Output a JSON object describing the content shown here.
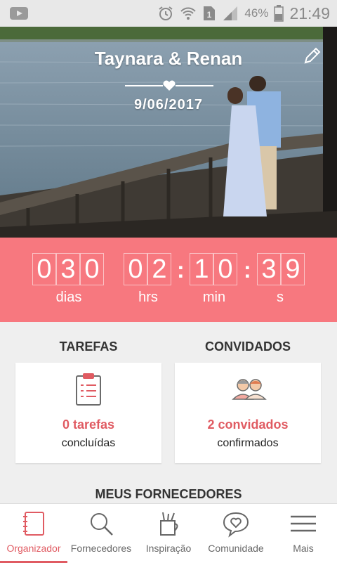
{
  "status_bar": {
    "battery_pct": "46%",
    "time": "21:49"
  },
  "hero": {
    "couple_names": "Taynara & Renan",
    "wedding_date": "9/06/2017"
  },
  "countdown": {
    "days": [
      "0",
      "3",
      "0"
    ],
    "hours": [
      "0",
      "2"
    ],
    "minutes": [
      "1",
      "0"
    ],
    "seconds": [
      "3",
      "9"
    ],
    "separator": ":",
    "labels": {
      "days": "dias",
      "hours": "hrs",
      "minutes": "min",
      "seconds": "s"
    }
  },
  "tasks": {
    "title": "TAREFAS",
    "count": "0 tarefas",
    "sub": "concluídas"
  },
  "guests": {
    "title": "CONVIDADOS",
    "count": "2 convidados",
    "sub": "confirmados"
  },
  "suppliers_title": "MEUS FORNECEDORES",
  "tabs": [
    {
      "label": "Organizador"
    },
    {
      "label": "Fornecedores"
    },
    {
      "label": "Inspiração"
    },
    {
      "label": "Comunidade"
    },
    {
      "label": "Mais"
    }
  ],
  "colors": {
    "accent": "#f7787f",
    "accent_text": "#e05b62"
  }
}
